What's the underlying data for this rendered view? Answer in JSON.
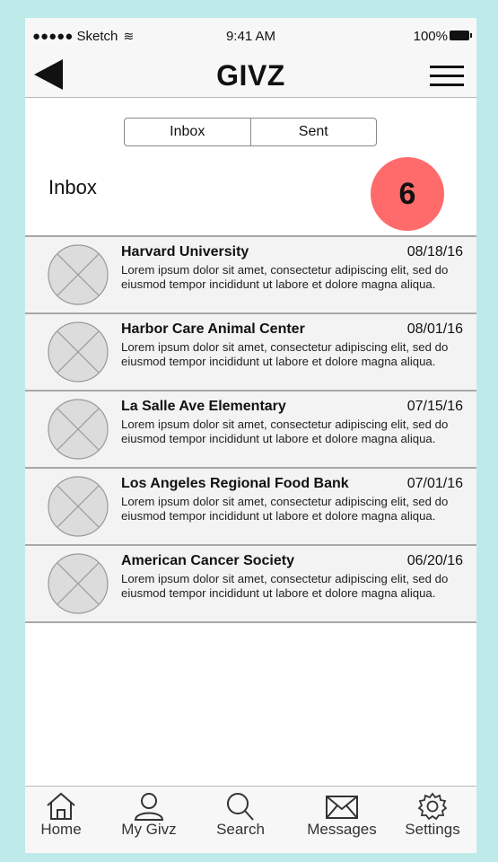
{
  "colors": {
    "background": "#bfeaea",
    "badge": "#ff6b6b"
  },
  "status_bar": {
    "carrier": "●●●●● Sketch",
    "time": "9:41 AM",
    "battery": "100%"
  },
  "nav": {
    "title": "GIVZ",
    "back_icon": "back-arrow-icon",
    "menu_icon": "hamburger-menu-icon"
  },
  "segment": {
    "items": [
      "Inbox",
      "Sent"
    ],
    "selected": "Inbox"
  },
  "section": {
    "title": "Inbox",
    "unread_count": "6"
  },
  "messages": [
    {
      "name": "Harvard University",
      "date": "08/18/16",
      "snippet": "Lorem ipsum dolor sit amet, consectetur adipiscing elit, sed do eiusmod tempor incididunt ut labore et dolore magna aliqua."
    },
    {
      "name": "Harbor Care Animal Center",
      "date": "08/01/16",
      "snippet": "Lorem ipsum dolor sit amet, consectetur adipiscing elit, sed do eiusmod tempor incididunt ut labore et dolore magna aliqua."
    },
    {
      "name": "La Salle Ave Elementary",
      "date": "07/15/16",
      "snippet": "Lorem ipsum dolor sit amet, consectetur adipiscing elit, sed do eiusmod tempor incididunt ut labore et dolore magna aliqua."
    },
    {
      "name": "Los Angeles Regional Food Bank",
      "date": "07/01/16",
      "snippet": "Lorem ipsum dolor sit amet, consectetur adipiscing elit, sed do eiusmod tempor incididunt ut labore et dolore magna aliqua."
    },
    {
      "name": "American Cancer Society",
      "date": "06/20/16",
      "snippet": "Lorem ipsum dolor sit amet, consectetur adipiscing elit, sed do eiusmod tempor incididunt ut labore et dolore magna aliqua."
    }
  ],
  "tabbar": {
    "items": [
      {
        "label": "Home",
        "icon": "home-icon"
      },
      {
        "label": "My Givz",
        "icon": "person-icon"
      },
      {
        "label": "Search",
        "icon": "search-icon"
      },
      {
        "label": "Messages",
        "icon": "envelope-icon"
      },
      {
        "label": "Settings",
        "icon": "gear-icon"
      }
    ]
  }
}
